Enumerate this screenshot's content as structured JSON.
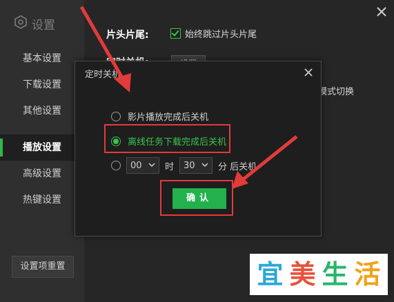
{
  "sidebar": {
    "title": "设置",
    "items": [
      {
        "label": "基本设置"
      },
      {
        "label": "下载设置"
      },
      {
        "label": "其他设置"
      },
      {
        "label": "播放设置"
      },
      {
        "label": "高级设置"
      },
      {
        "label": "热键设置"
      }
    ],
    "active_index": 3,
    "reset_label": "设置项重置"
  },
  "main": {
    "label_head_tail": "片头片尾:",
    "skip_checkbox_label": "始终跳过片头片尾",
    "skip_checked": true,
    "timer_label": "定时关机:",
    "timer_button": "设置",
    "mode_switch_partial": "模式切换"
  },
  "dialog": {
    "title": "定时关机",
    "options": [
      {
        "label": "影片播放完成后关机",
        "checked": false
      },
      {
        "label": "离线任务下载完成后关机",
        "checked": true
      }
    ],
    "time_option": {
      "hour": "00",
      "hour_unit": "时",
      "minute": "30",
      "minute_unit": "分 后关机",
      "checked": false
    },
    "confirm_label": "确认"
  },
  "colors": {
    "accent": "#3bc24f",
    "highlight": "#e23b3b",
    "background": "#262626"
  },
  "watermark": {
    "chars": [
      "宜",
      "美",
      "生",
      "活"
    ]
  }
}
